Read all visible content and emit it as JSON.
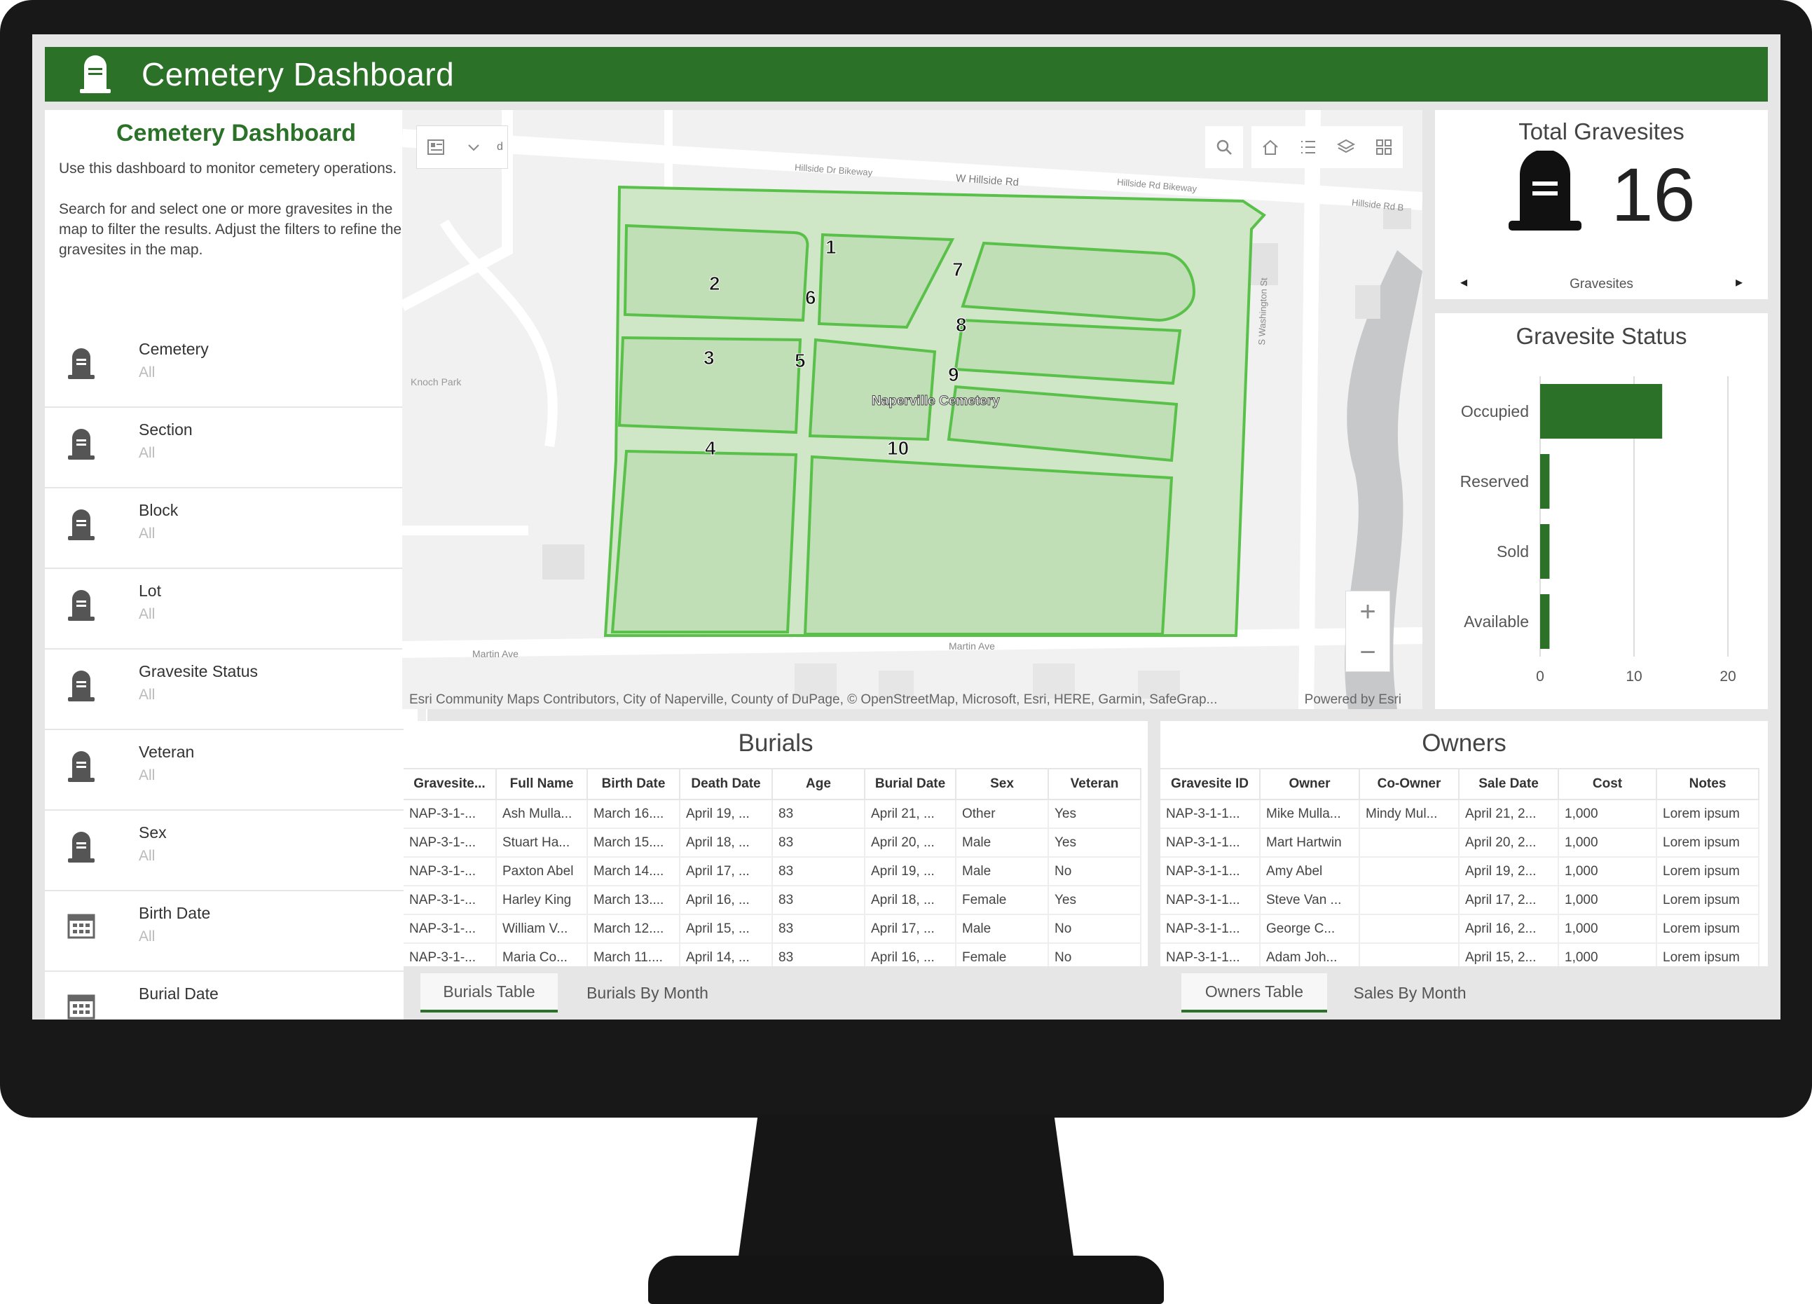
{
  "header": {
    "title": "Cemetery Dashboard",
    "logo_icon": "gravestone-icon"
  },
  "sidebar": {
    "title": "Cemetery Dashboard",
    "desc1": "Use this dashboard to monitor cemetery operations.",
    "desc2": "Search for and select one or more gravesites in the map to filter the results. Adjust the filters to refine the gravesites in the map.",
    "filters": [
      {
        "name": "Cemetery",
        "value": "All",
        "icon": "gravestone-icon"
      },
      {
        "name": "Section",
        "value": "All",
        "icon": "gravestone-icon"
      },
      {
        "name": "Block",
        "value": "All",
        "icon": "gravestone-icon"
      },
      {
        "name": "Lot",
        "value": "All",
        "icon": "gravestone-icon"
      },
      {
        "name": "Gravesite Status",
        "value": "All",
        "icon": "gravestone-icon"
      },
      {
        "name": "Veteran",
        "value": "All",
        "icon": "gravestone-icon"
      },
      {
        "name": "Sex",
        "value": "All",
        "icon": "gravestone-icon"
      },
      {
        "name": "Birth Date",
        "value": "All",
        "icon": "calendar-icon"
      },
      {
        "name": "Burial Date",
        "value": "",
        "icon": "calendar-icon"
      }
    ]
  },
  "map": {
    "streets": {
      "hillside_bikeway": "Hillside Dr Bikeway",
      "w_hillside": "W Hillside Rd",
      "hillside_rd_bikeway": "Hillside Rd Bikeway",
      "hillside_rd_b": "Hillside Rd B",
      "washington": "S Washington St",
      "martin1": "Martin Ave",
      "martin2": "Martin Ave",
      "knoch": "Knoch Park"
    },
    "cemetery_label": "Naperville Cemetery",
    "sections": [
      "1",
      "2",
      "3",
      "4",
      "5",
      "6",
      "7",
      "8",
      "9",
      "10"
    ],
    "attribution": "Esri Community Maps Contributors, City of Naperville, County of DuPage, © OpenStreetMap, Microsoft, Esri, HERE, Garmin, SafeGrap...",
    "powered": "Powered by Esri",
    "search_fragment": "d",
    "zoom_in": "+",
    "zoom_out": "−"
  },
  "total": {
    "title": "Total Gravesites",
    "value": "16",
    "footer": "Gravesites",
    "prev": "◂",
    "next": "▸"
  },
  "status_chart": {
    "title": "Gravesite Status"
  },
  "chart_data": {
    "type": "bar",
    "orientation": "horizontal",
    "title": "Gravesite Status",
    "categories": [
      "Occupied",
      "Reserved",
      "Sold",
      "Available"
    ],
    "values": [
      13,
      1,
      1,
      1
    ],
    "xlim": [
      0,
      20
    ],
    "ticks": [
      "0",
      "10",
      "20"
    ],
    "color": "#2b7228"
  },
  "burials": {
    "title": "Burials",
    "columns": [
      "Gravesite...",
      "Full Name",
      "Birth Date",
      "Death Date",
      "Age",
      "Burial Date",
      "Sex",
      "Veteran"
    ],
    "rows": [
      [
        "NAP-3-1-...",
        "Ash Mulla...",
        "March 16....",
        "April 19, ...",
        "83",
        "April 21, ...",
        "Other",
        "Yes"
      ],
      [
        "NAP-3-1-...",
        "Stuart Ha...",
        "March 15....",
        "April 18, ...",
        "83",
        "April 20, ...",
        "Male",
        "Yes"
      ],
      [
        "NAP-3-1-...",
        "Paxton Abel",
        "March 14....",
        "April 17, ...",
        "83",
        "April 19, ...",
        "Male",
        "No"
      ],
      [
        "NAP-3-1-...",
        "Harley King",
        "March 13....",
        "April 16, ...",
        "83",
        "April 18, ...",
        "Female",
        "Yes"
      ],
      [
        "NAP-3-1-...",
        "William V...",
        "March 12....",
        "April 15, ...",
        "83",
        "April 17, ...",
        "Male",
        "No"
      ],
      [
        "NAP-3-1-...",
        "Maria Co...",
        "March 11....",
        "April 14, ...",
        "83",
        "April 16, ...",
        "Female",
        "No"
      ]
    ],
    "tabs": [
      "Burials Table",
      "Burials By Month"
    ]
  },
  "owners": {
    "title": "Owners",
    "columns": [
      "Gravesite ID",
      "Owner",
      "Co-Owner",
      "Sale Date",
      "Cost",
      "Notes"
    ],
    "rows": [
      [
        "NAP-3-1-1...",
        "Mike Mulla...",
        "Mindy Mul...",
        "April 21, 2...",
        "1,000",
        "Lorem ipsum"
      ],
      [
        "NAP-3-1-1...",
        "Mart Hartwin",
        "",
        "April 20, 2...",
        "1,000",
        "Lorem ipsum"
      ],
      [
        "NAP-3-1-1...",
        "Amy Abel",
        "",
        "April 19, 2...",
        "1,000",
        "Lorem ipsum"
      ],
      [
        "NAP-3-1-1...",
        "Steve Van ...",
        "",
        "April 17, 2...",
        "1,000",
        "Lorem ipsum"
      ],
      [
        "NAP-3-1-1...",
        "George C...",
        "",
        "April 16, 2...",
        "1,000",
        "Lorem ipsum"
      ],
      [
        "NAP-3-1-1...",
        "Adam Joh...",
        "",
        "April 15, 2...",
        "1,000",
        "Lorem ipsum"
      ]
    ],
    "tabs": [
      "Owners Table",
      "Sales By Month"
    ]
  }
}
